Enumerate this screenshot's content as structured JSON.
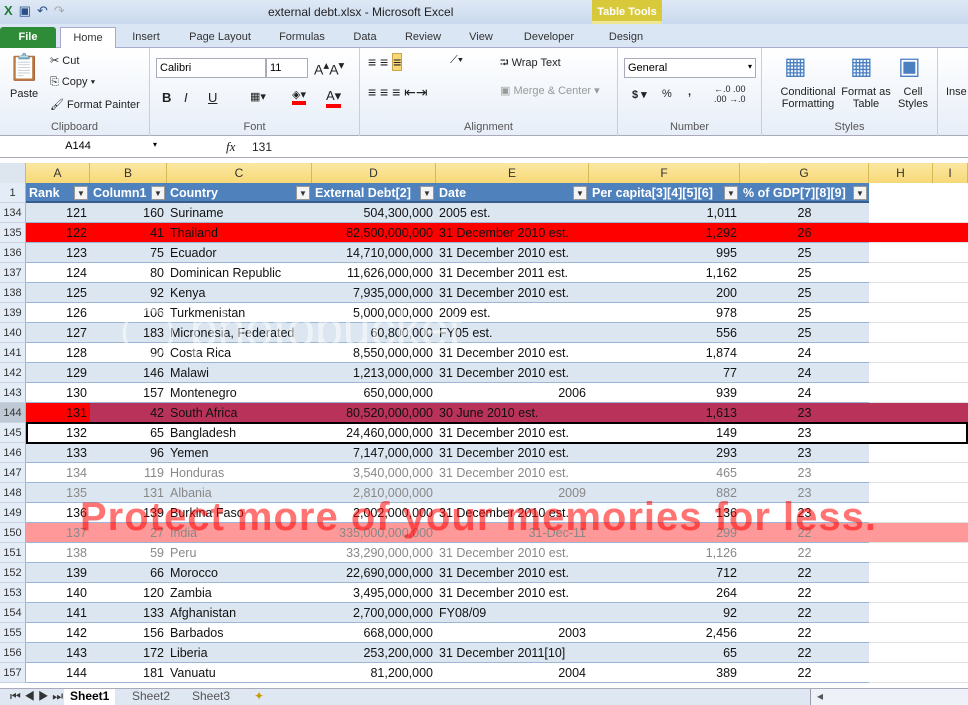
{
  "app": {
    "title": "external debt.xlsx - Microsoft Excel",
    "context_tab_group": "Table Tools"
  },
  "tabs": [
    "File",
    "Home",
    "Insert",
    "Page Layout",
    "Formulas",
    "Data",
    "Review",
    "View",
    "Developer",
    "Design"
  ],
  "ribbon": {
    "clipboard": {
      "label": "Clipboard",
      "paste": "Paste",
      "cut": "Cut",
      "copy": "Copy",
      "format_painter": "Format Painter"
    },
    "font": {
      "label": "Font",
      "name": "Calibri",
      "size": "11",
      "bold": "B",
      "italic": "I",
      "underline": "U"
    },
    "alignment": {
      "label": "Alignment",
      "wrap": "Wrap Text",
      "merge": "Merge & Center"
    },
    "number": {
      "label": "Number",
      "format": "General",
      "currency": "$",
      "percent": "%",
      "comma": ","
    },
    "styles": {
      "label": "Styles",
      "conditional": "Conditional Formatting",
      "format_table": "Format as Table",
      "cell_styles": "Cell Styles"
    },
    "cells": {
      "insert": "Inse"
    }
  },
  "formula_bar": {
    "name_box": "A144",
    "fx": "fx",
    "value": "131"
  },
  "columns": [
    "A",
    "B",
    "C",
    "D",
    "E",
    "F",
    "G",
    "H",
    "I"
  ],
  "headers": [
    "Rank",
    "Column1",
    "Country",
    "External Debt[2]",
    "Date",
    "Per capita[3][4][5][6]",
    "% of GDP[7][8][9]"
  ],
  "rows": [
    [
      "134",
      "121",
      "160",
      "Suriname",
      "504,300,000",
      "2005 est.",
      "1,011",
      "28"
    ],
    [
      "135",
      "122",
      "41",
      "Thailand",
      "82,500,000,000",
      "31 December 2010 est.",
      "1,292",
      "26"
    ],
    [
      "136",
      "123",
      "75",
      "Ecuador",
      "14,710,000,000",
      "31 December 2010 est.",
      "995",
      "25"
    ],
    [
      "137",
      "124",
      "80",
      "Dominican Republic",
      "11,626,000,000",
      "31 December 2011 est.",
      "1,162",
      "25"
    ],
    [
      "138",
      "125",
      "92",
      "Kenya",
      "7,935,000,000",
      "31 December 2010 est.",
      "200",
      "25"
    ],
    [
      "139",
      "126",
      "106",
      "Turkmenistan",
      "5,000,000,000",
      "2009 est.",
      "978",
      "25"
    ],
    [
      "140",
      "127",
      "183",
      "Micronesia, Federated",
      "60,800,000",
      "FY05 est.",
      "556",
      "25"
    ],
    [
      "141",
      "128",
      "90",
      "Costa Rica",
      "8,550,000,000",
      "31 December 2010 est.",
      "1,874",
      "24"
    ],
    [
      "142",
      "129",
      "146",
      "Malawi",
      "1,213,000,000",
      "31 December 2010 est.",
      "77",
      "24"
    ],
    [
      "143",
      "130",
      "157",
      "Montenegro",
      "650,000,000",
      "2006",
      "939",
      "24"
    ],
    [
      "144",
      "131",
      "42",
      "South Africa",
      "80,520,000,000",
      "30 June 2010 est.",
      "1,613",
      "23"
    ],
    [
      "145",
      "132",
      "65",
      "Bangladesh",
      "24,460,000,000",
      "31 December 2010 est.",
      "149",
      "23"
    ],
    [
      "146",
      "133",
      "96",
      "Yemen",
      "7,147,000,000",
      "31 December 2010 est.",
      "293",
      "23"
    ],
    [
      "147",
      "134",
      "119",
      "Honduras",
      "3,540,000,000",
      "31 December 2010 est.",
      "465",
      "23"
    ],
    [
      "148",
      "135",
      "131",
      "Albania",
      "2,810,000,000",
      "2009",
      "882",
      "23"
    ],
    [
      "149",
      "136",
      "139",
      "Burkina Faso",
      "2,002,000,000",
      "31 December 2010 est.",
      "136",
      "23"
    ],
    [
      "150",
      "137",
      "27",
      "India",
      "335,000,000,000",
      "31-Dec-11",
      "299",
      "22"
    ],
    [
      "151",
      "138",
      "59",
      "Peru",
      "33,290,000,000",
      "31 December 2010 est.",
      "1,126",
      "22"
    ],
    [
      "152",
      "139",
      "66",
      "Morocco",
      "22,690,000,000",
      "31 December 2010 est.",
      "712",
      "22"
    ],
    [
      "153",
      "140",
      "120",
      "Zambia",
      "3,495,000,000",
      "31 December 2010 est.",
      "264",
      "22"
    ],
    [
      "154",
      "141",
      "133",
      "Afghanistan",
      "2,700,000,000",
      "FY08/09",
      "92",
      "22"
    ],
    [
      "155",
      "142",
      "156",
      "Barbados",
      "668,000,000",
      "2003",
      "2,456",
      "22"
    ],
    [
      "156",
      "143",
      "172",
      "Liberia",
      "253,200,000",
      "31 December 2011[10]",
      "65",
      "22"
    ],
    [
      "157",
      "144",
      "181",
      "Vanuatu",
      "81,200,000",
      "2004",
      "389",
      "22"
    ]
  ],
  "watermark": "Protect more of your memories for less.",
  "sheets": [
    "Sheet1",
    "Sheet2",
    "Sheet3"
  ],
  "colors": {
    "header": "#4f81bd",
    "band": "#dce6f1",
    "red": "#ff0000",
    "selected_row": "#b8325a",
    "pink": "#ff9999"
  }
}
